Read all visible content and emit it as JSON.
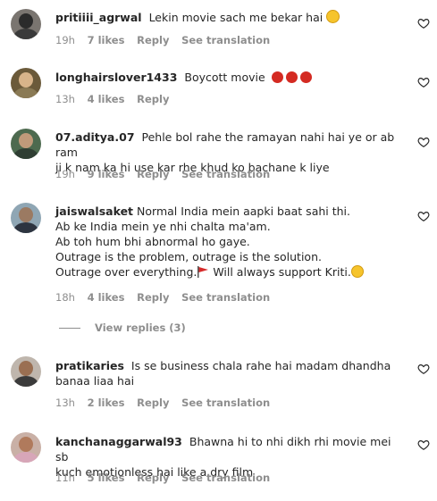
{
  "comments": [
    {
      "username": "pritiiii_agrwal",
      "text": "Lekin movie sach me bekar hai",
      "time": "19h",
      "likes": "7 likes",
      "reply": "Reply",
      "translate": "See translation",
      "avatar_colors": {
        "bg": "#7a7570",
        "head": "#2b2b2b",
        "body": "#3a3a3a"
      }
    },
    {
      "username": "longhairslover1433",
      "text": "Boycott movie",
      "time": "13h",
      "likes": "4 likes",
      "reply": "Reply",
      "translate": "",
      "avatar_colors": {
        "bg": "#6b5a3a",
        "head": "#d8b48a",
        "body": "#8a7a55"
      }
    },
    {
      "username": "07.aditya.07",
      "text": "Pehle bol rahe the ramayan nahi hai ye or ab ram\nji k nam ka hi use kar rhe khud ko bachane k liye",
      "time": "19h",
      "likes": "9 likes",
      "reply": "Reply",
      "translate": "See translation",
      "avatar_colors": {
        "bg": "#4d6a4f",
        "head": "#c09a7a",
        "body": "#2f3e33"
      }
    },
    {
      "username": "jaiswalsaket",
      "text": "Normal India mein aapki baat sahi thi.\nAb ke India mein ye nhi chalta ma'am.\nAb toh hum bhi abnormal ho gaye.\nOutrage is the problem, outrage is the solution.\nOutrage over everything.",
      "text_after": " Will always support Kriti.",
      "time": "18h",
      "likes": "4 likes",
      "reply": "Reply",
      "translate": "See translation",
      "avatar_colors": {
        "bg": "#8fa6b4",
        "head": "#9b7a62",
        "body": "#2d3440"
      }
    },
    {
      "username": "pratikaries",
      "text": "Is se business chala rahe hai madam dhandha\nbanaa liaa hai",
      "time": "13h",
      "likes": "2 likes",
      "reply": "Reply",
      "translate": "See translation",
      "avatar_colors": {
        "bg": "#bfb6ad",
        "head": "#9a6f52",
        "body": "#3b3b3b"
      }
    },
    {
      "username": "kanchanaggarwal93",
      "text": "Bhawna hi to nhi dikh rhi movie mei sb\nkuch emotionless hai like a dry film",
      "time": "11h",
      "likes": "5 likes",
      "reply": "Reply",
      "translate": "See translation",
      "avatar_colors": {
        "bg": "#c9b0a6",
        "head": "#b07a5c",
        "body": "#d7a6b8"
      }
    }
  ],
  "view_replies": "View replies (3)"
}
